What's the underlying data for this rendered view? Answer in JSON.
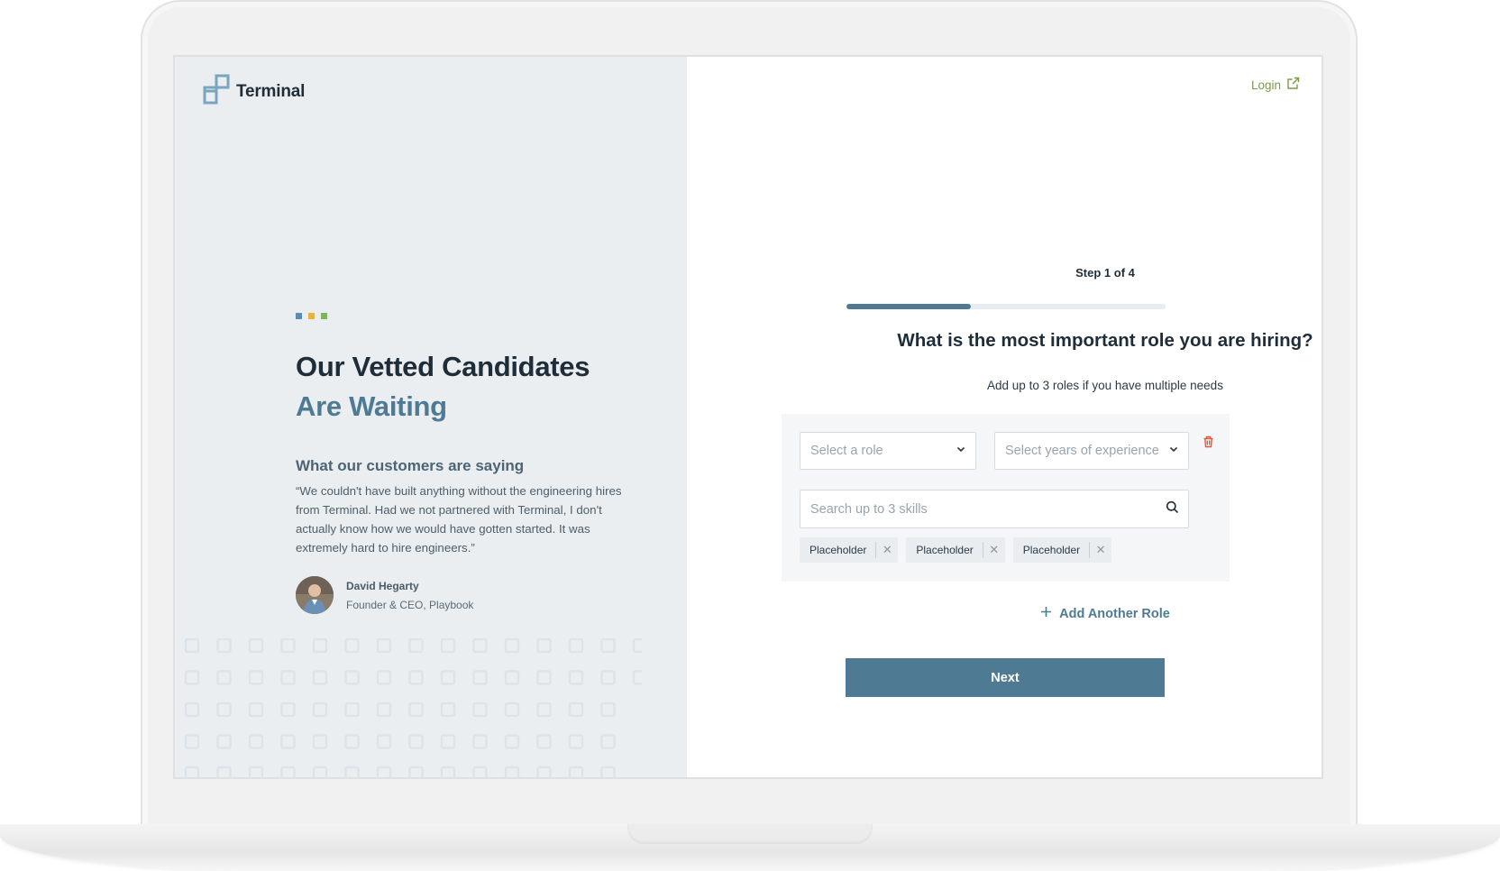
{
  "brand": {
    "name": "Terminal"
  },
  "header": {
    "login_label": "Login"
  },
  "left": {
    "headline_line1": "Our Vetted Candidates",
    "headline_line2": "Are Waiting",
    "accent_dots": [
      "#5b8db0",
      "#e7b43e",
      "#7fb55a"
    ],
    "testimonial": {
      "title": "What our customers are saying",
      "quote": "“We couldn't have built anything without the engineering hires from Terminal. Had we not partnered with Terminal, I don't actually know how we would have gotten started. It was extremely hard to hire engineers.”",
      "author_name": "David Hegarty",
      "author_title": "Founder & CEO, Playbook"
    }
  },
  "form": {
    "step_label": "Step 1 of 4",
    "progress_fraction": 0.39,
    "question": "What is the most important role you are hiring?",
    "subtitle": "Add up to 3 roles if you have multiple needs",
    "role_select_placeholder": "Select a role",
    "years_select_placeholder": "Select years of experience",
    "skills_search_placeholder": "Search up to 3 skills",
    "skill_chips": [
      "Placeholder",
      "Placeholder",
      "Placeholder"
    ],
    "add_role_label": "Add Another Role",
    "next_label": "Next"
  },
  "icons": {
    "logo": "terminal-logo-icon",
    "login": "external-link-icon",
    "select": "chevron-down-icon",
    "search": "search-icon",
    "delete": "trash-icon",
    "add": "plus-icon",
    "chip_remove": "close-icon"
  },
  "colors": {
    "accent": "#4f7a93",
    "login": "#7d9a4a",
    "delete": "#e0583c",
    "left_bg": "#eaeef1"
  }
}
